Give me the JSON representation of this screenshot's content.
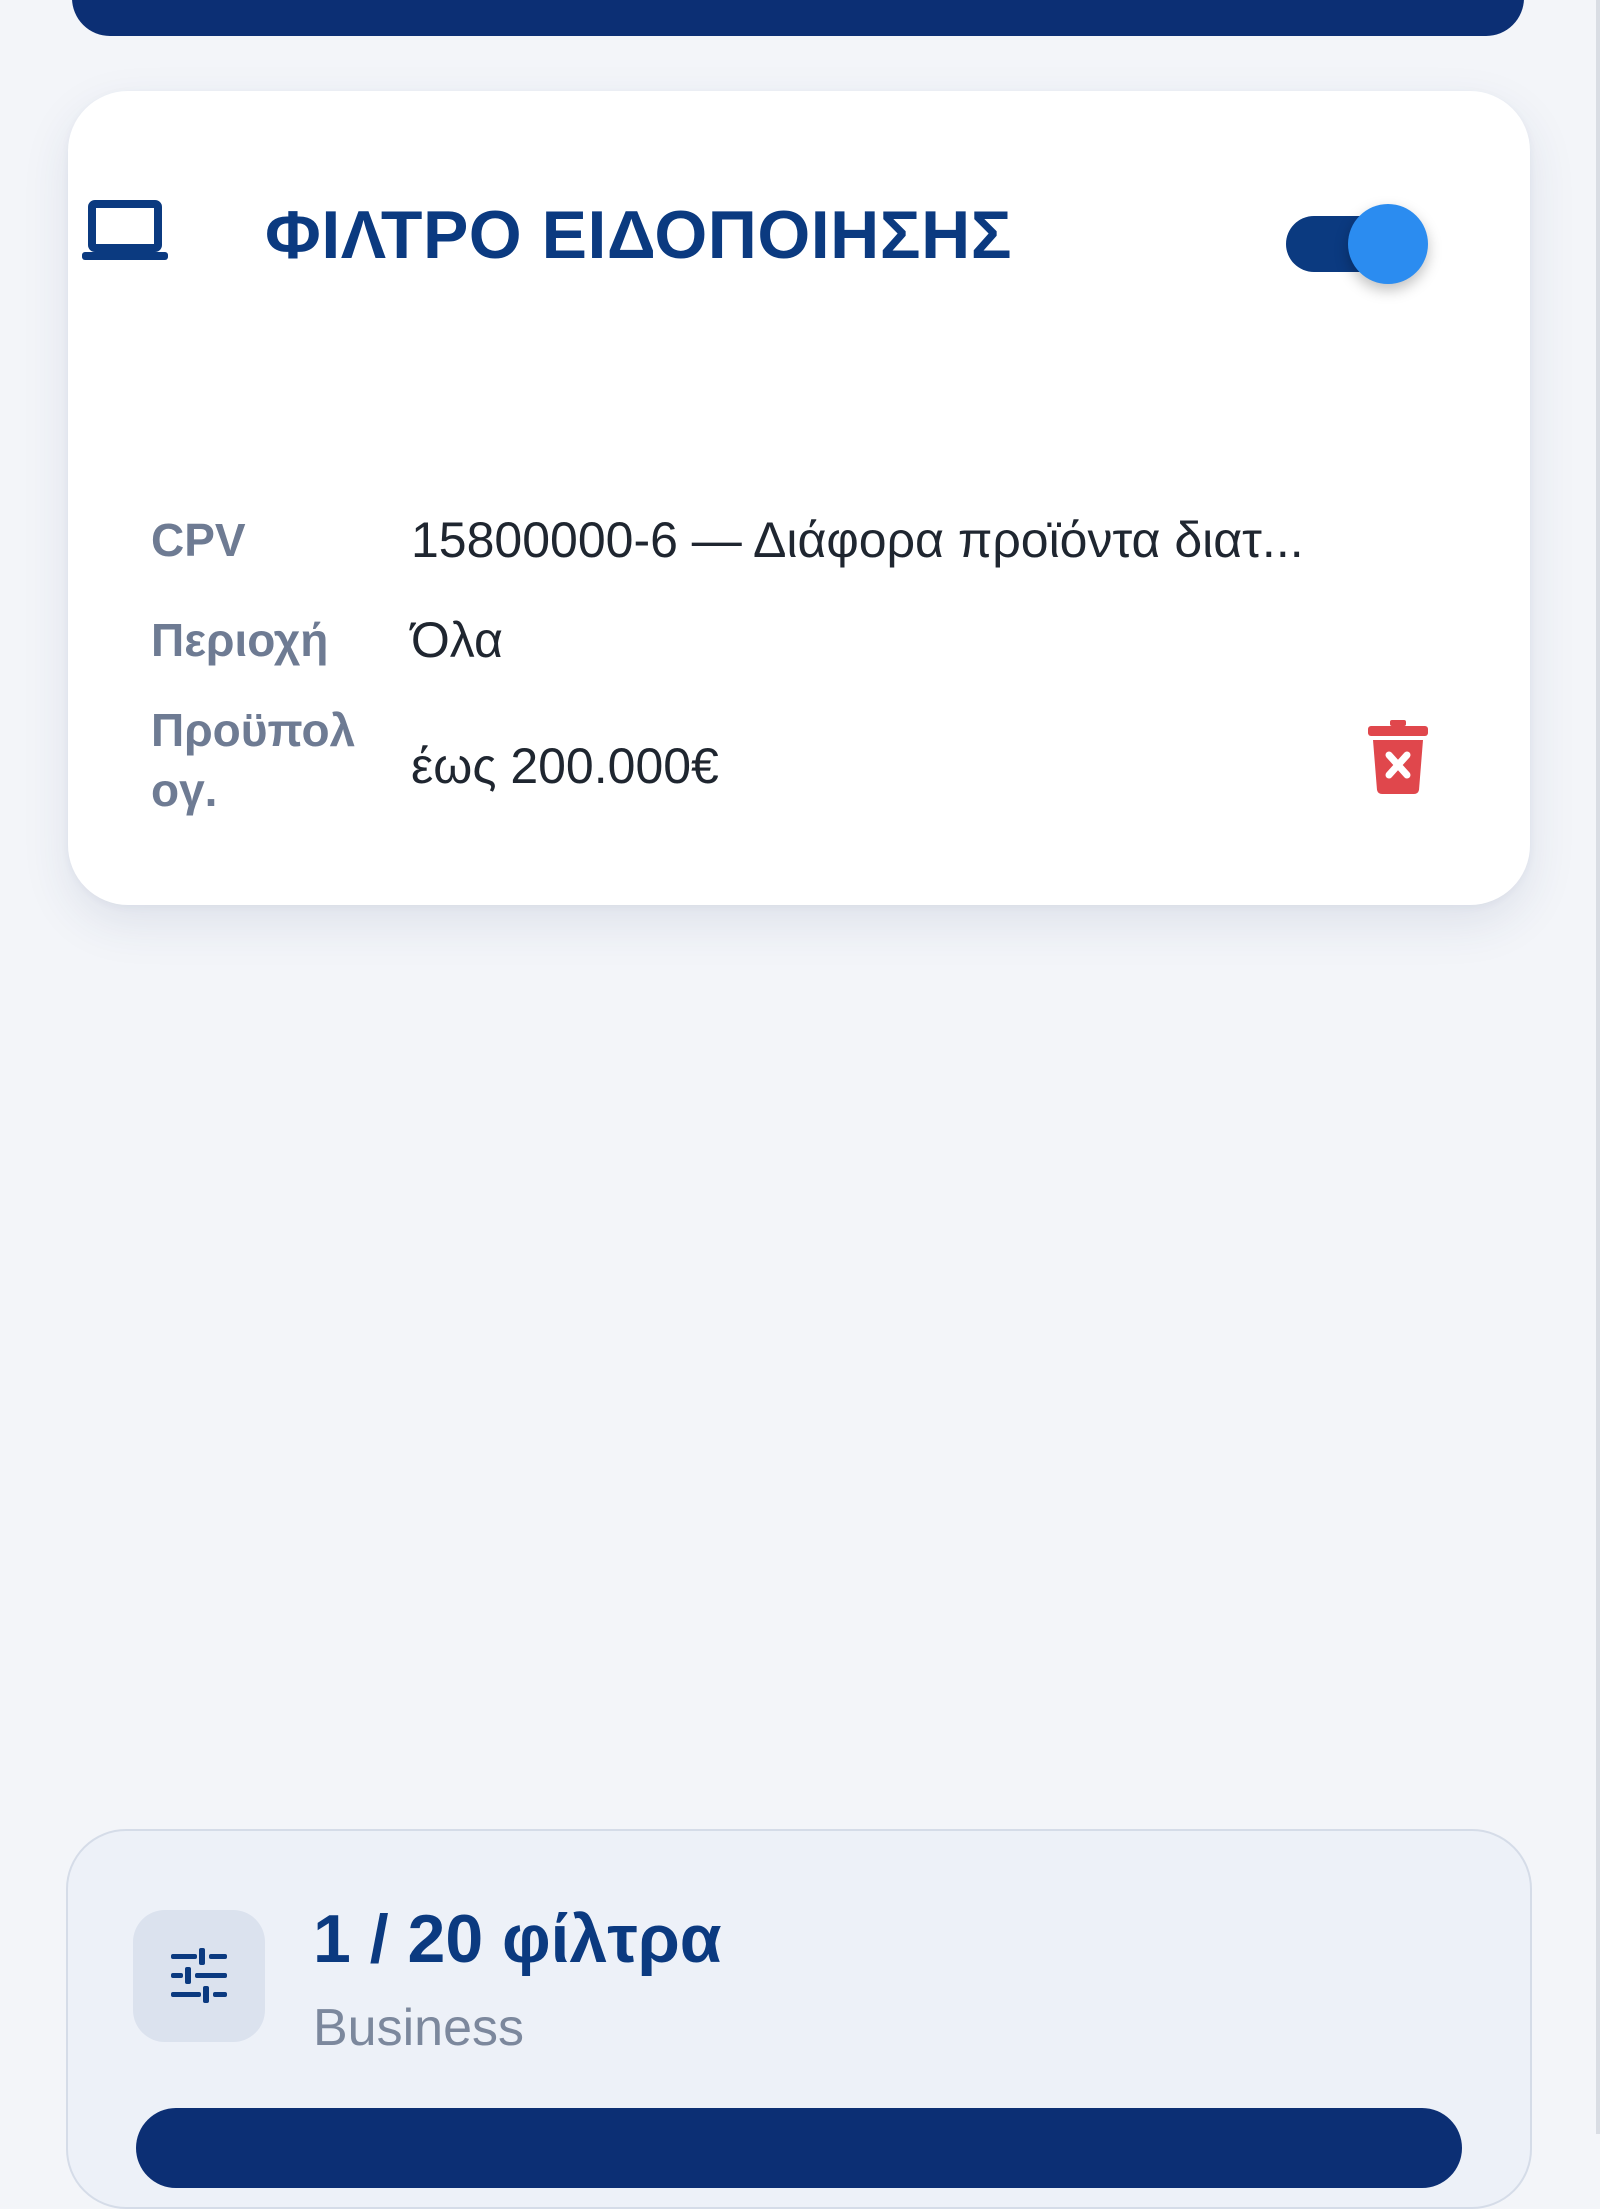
{
  "filter_card": {
    "title": "ΦΙΛΤΡΟ ΕΙΔΟΠΟΙΗΣΗΣ",
    "icon": "laptop-icon",
    "enabled": true,
    "rows": [
      {
        "label": "CPV",
        "value": "15800000-6 — Διάφορα προϊόντα διατ..."
      },
      {
        "label": "Περιοχή",
        "value": "Όλα"
      },
      {
        "label": "Προϋπολ\nογ.",
        "value": "έως 200.000€"
      }
    ],
    "delete_icon": "trash-icon"
  },
  "plan": {
    "count_label": "1 / 20 φίλτρα",
    "tier": "Business",
    "icon": "sliders-icon"
  },
  "colors": {
    "primary": "#0b3a80",
    "toggle_knob": "#2b8cf0",
    "delete": "#e0474c",
    "background": "#f3f5f9"
  }
}
